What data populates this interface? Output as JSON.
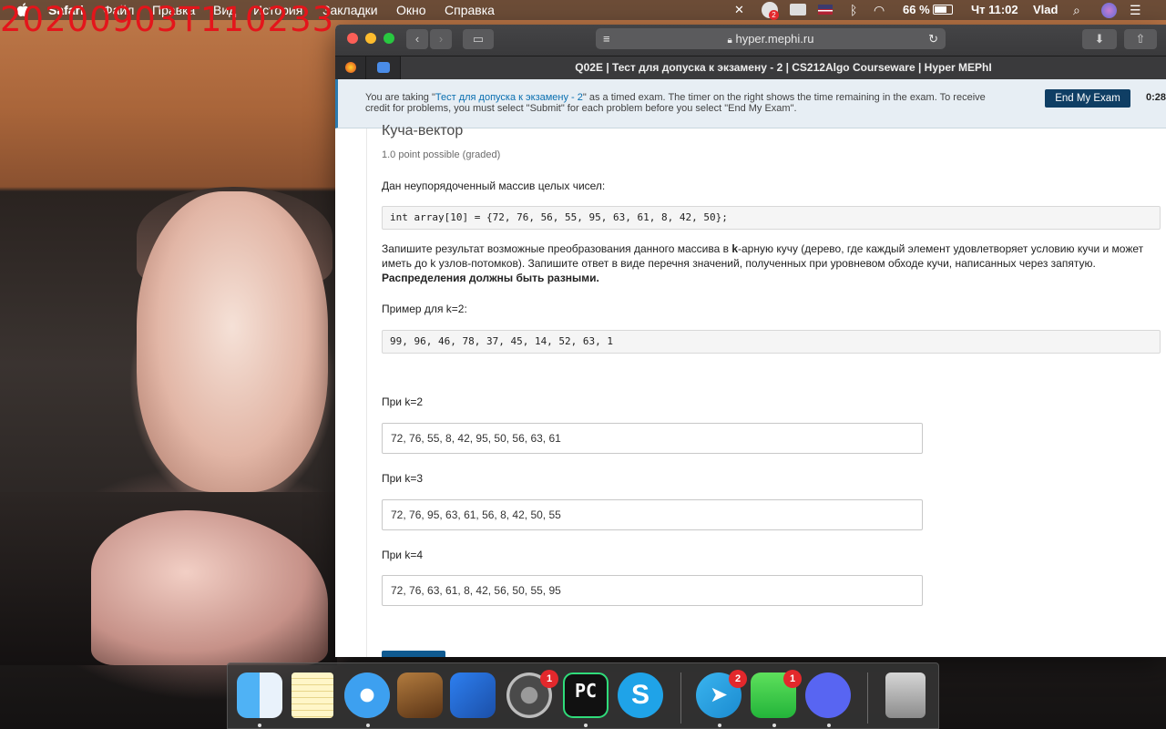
{
  "overlay": {
    "timestamp": "20200903T110233"
  },
  "menubar": {
    "app": "Safari",
    "items": [
      "Файл",
      "Правка",
      "Вид",
      "История",
      "Закладки",
      "Окно",
      "Справка"
    ],
    "status": {
      "notification_count": "2",
      "battery": "66 %",
      "clock": "Чт 11:02",
      "user": "Vlad"
    }
  },
  "browser": {
    "url": "hyper.mephi.ru",
    "tab_title": "Q02E | Тест для допуска к экзамену - 2 | CS212Algo Courseware | Hyper MEPhI"
  },
  "exam_banner": {
    "text_before": "You are taking \"",
    "exam_name": "Тест для допуска к экзамену - 2",
    "text_after": "\" as a timed exam. The timer on the right shows the time remaining in the exam. To receive credit for problems, you must select \"Submit\" for each problem before you select \"End My Exam\".",
    "end_button": "End My Exam",
    "timer": "0:28:"
  },
  "problem": {
    "title": "Куча-вектор",
    "points": "1.0 point possible (graded)",
    "intro": "Дан неупорядоченный массив целых чисел:",
    "code_array": "int array[10] = {72, 76, 56, 55, 95, 63, 61, 8, 42, 50};",
    "instr_1": "Запишите результат возможные преобразования данного массива в ",
    "instr_k": "k",
    "instr_2": "-арную кучу (дерево, где каждый элемент удовлетворяет условию кучи и может иметь до k узлов-потомков). Запишите ответ в виде перечня значений, полученных при уровневом обходе кучи, написанных через запятую. ",
    "instr_bold": "Распределения должны быть разными.",
    "example_label": "Пример для k=2:",
    "example_code": "99, 96, 46, 78, 37, 45, 14, 52, 63, 1",
    "answers": [
      {
        "label": "При k=2",
        "value": "72, 76, 55, 8, 42, 95, 50, 56, 63, 61"
      },
      {
        "label": "При k=3",
        "value": "72, 76, 95, 63, 61, 56, 8, 42, 50, 55"
      },
      {
        "label": "При k=4",
        "value": "72, 76, 63, 61, 8, 42, 56, 50, 55, 95"
      }
    ]
  },
  "dock": {
    "badges": {
      "system_preferences": "1",
      "telegram": "2",
      "facetime": "1"
    },
    "pycharm_label": "PC"
  }
}
